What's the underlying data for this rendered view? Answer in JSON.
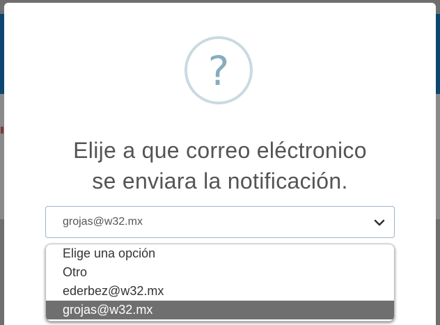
{
  "dialog": {
    "icon": "question-circle-icon",
    "icon_glyph": "?",
    "title_line1": "Elije a que correo eléctronico",
    "title_line2": "se enviara la notificación."
  },
  "email_select": {
    "selected_value": "grojas@w32.mx",
    "options": [
      {
        "label": "Elige una opción",
        "selected": false
      },
      {
        "label": "Otro",
        "selected": false
      },
      {
        "label": "ederbez@w32.mx",
        "selected": false
      },
      {
        "label": "grojas@w32.mx",
        "selected": true
      }
    ]
  },
  "colors": {
    "overlay": "#6f6f6f",
    "icon_ring": "#c9dae1",
    "icon_mark": "#87adbd",
    "title_text": "#545454",
    "select_border": "#9fb2c7",
    "selected_option_bg": "#6f6f6f"
  }
}
